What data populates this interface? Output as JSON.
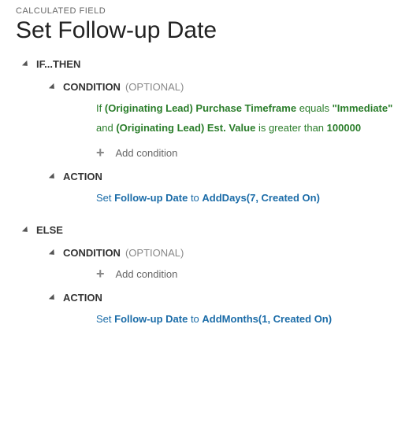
{
  "breadcrumb": "CALCULATED FIELD",
  "title": "Set Follow-up Date",
  "sections": {
    "ifthen": {
      "label": "IF...THEN"
    },
    "else": {
      "label": "ELSE"
    },
    "condition": {
      "label": "CONDITION",
      "optional": "(OPTIONAL)"
    },
    "action": {
      "label": "ACTION"
    }
  },
  "words": {
    "if": "If",
    "and": "and",
    "equals": "equals",
    "isGreaterThan": "is greater than",
    "set": "Set",
    "to": "to"
  },
  "ifBranch": {
    "cond1": {
      "field": "(Originating Lead) Purchase Timeframe",
      "literal": "\"Immediate\""
    },
    "cond2": {
      "field": "(Originating Lead) Est. Value",
      "literal": "100000"
    },
    "action": {
      "field": "Follow-up Date",
      "fn": "AddDays(7, Created On)"
    }
  },
  "elseBranch": {
    "action": {
      "field": "Follow-up Date",
      "fn": "AddMonths(1, Created On)"
    }
  },
  "ui": {
    "addCondition": "Add condition"
  }
}
